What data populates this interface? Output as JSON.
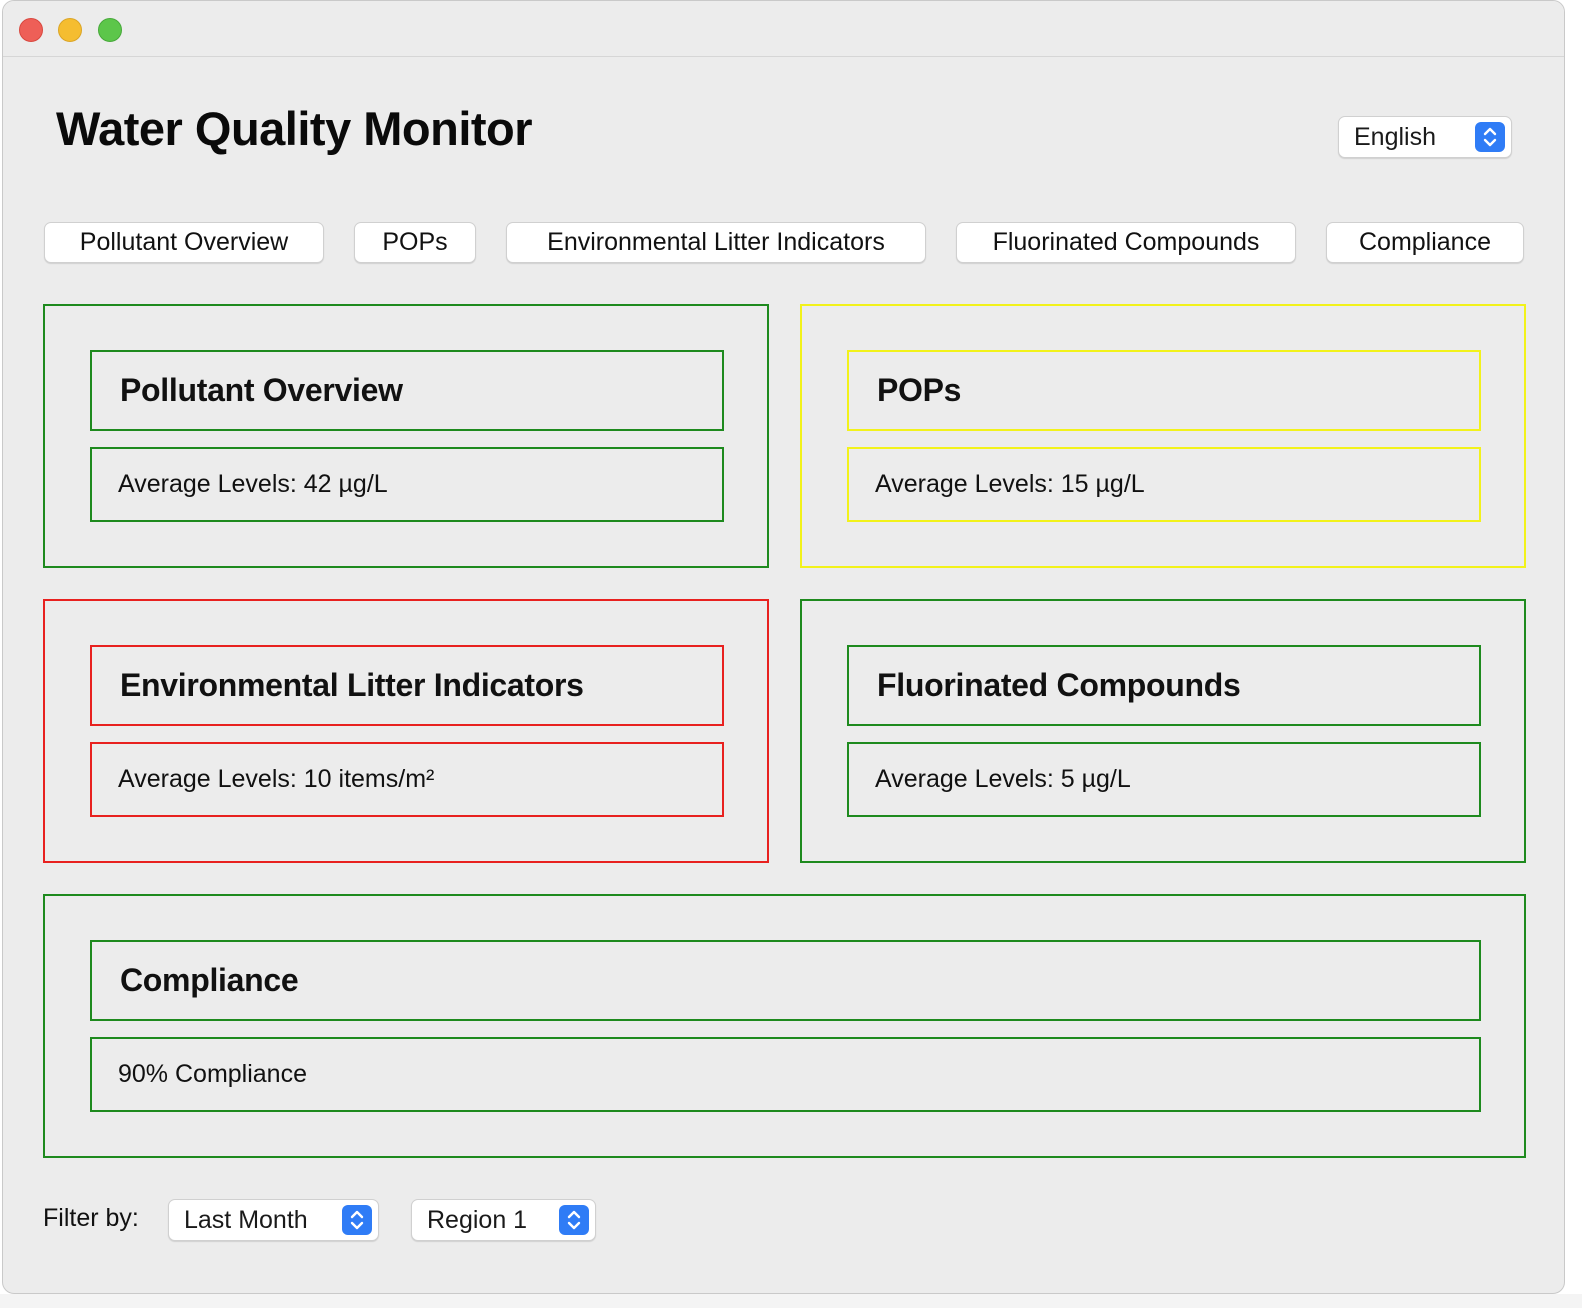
{
  "window": {
    "title": ""
  },
  "header": {
    "title": "Water Quality Monitor"
  },
  "language": {
    "selected": "English"
  },
  "tabs": [
    {
      "label": "Pollutant Overview"
    },
    {
      "label": "POPs"
    },
    {
      "label": "Environmental Litter Indicators"
    },
    {
      "label": "Fluorinated Compounds"
    },
    {
      "label": "Compliance"
    }
  ],
  "panels": [
    {
      "title": "Pollutant Overview",
      "value": "Average Levels: 42 µg/L",
      "status_color": "#1e8a1e"
    },
    {
      "title": "POPs",
      "value": "Average Levels: 15 µg/L",
      "status_color": "#f2f21a"
    },
    {
      "title": "Environmental Litter Indicators",
      "value": "Average Levels: 10 items/m²",
      "status_color": "#e8211f"
    },
    {
      "title": "Fluorinated Compounds",
      "value": "Average Levels: 5 µg/L",
      "status_color": "#1e8a1e"
    },
    {
      "title": "Compliance",
      "value": "90% Compliance",
      "status_color": "#1e8a1e"
    }
  ],
  "filters": {
    "label": "Filter by:",
    "period": "Last Month",
    "region": "Region 1"
  },
  "colors": {
    "accent": "#2f7cf6",
    "ok": "#1e8a1e",
    "warning": "#f2f21a",
    "alert": "#e8211f"
  }
}
